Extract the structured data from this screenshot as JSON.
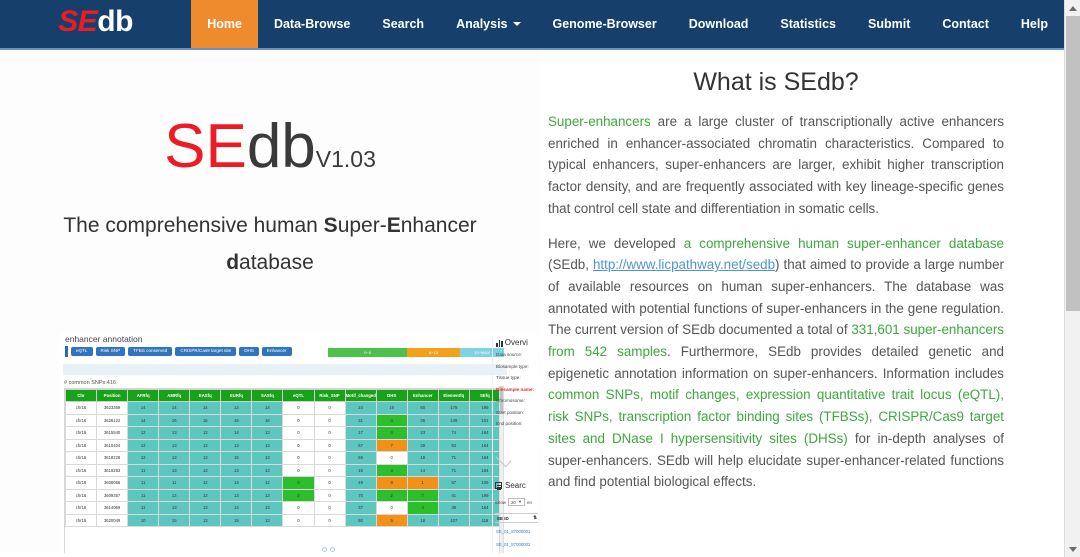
{
  "navbar": {
    "brand_se": "SE",
    "brand_db": "db",
    "items": [
      {
        "label": "Home",
        "active": true
      },
      {
        "label": "Data-Browse",
        "active": false
      },
      {
        "label": "Search",
        "active": false
      },
      {
        "label": "Analysis",
        "active": false,
        "dropdown": true
      },
      {
        "label": "Genome-Browser",
        "active": false
      },
      {
        "label": "Download",
        "active": false
      },
      {
        "label": "Statistics",
        "active": false
      },
      {
        "label": "Submit",
        "active": false
      },
      {
        "label": "Contact",
        "active": false
      },
      {
        "label": "Help",
        "active": false
      }
    ],
    "colors": {
      "bar": "#16406B",
      "active": "#EE8C2D",
      "accent_red": "#ED1C24"
    }
  },
  "hero": {
    "logo_se": "SE",
    "logo_db": "db",
    "logo_version": "V1.03",
    "tagline_pre": "The comprehensive human ",
    "tagline_s": "S",
    "tagline_uper": "uper-",
    "tagline_e": "E",
    "tagline_nhancer": "nhancer",
    "tagline_d": "d",
    "tagline_atabase": "atabase"
  },
  "screenshot": {
    "title": "enhancer annotation",
    "badges": [
      "eQTL",
      "Risk SNP",
      "TFBS conserved",
      "CRISPR/Cas9 target site",
      "DHS",
      "Enhancer"
    ],
    "legend": [
      {
        "label": "0~5",
        "color": "#4CC14C"
      },
      {
        "label": "6~10",
        "color": "#F5A117"
      },
      {
        "label": "10~MAX",
        "color": "#7FD4E3"
      }
    ],
    "snp_note": "# common SNPs:416",
    "table": {
      "headers": [
        "Chr",
        "Position",
        "AFRfq",
        "AMRfq",
        "EASfq",
        "EURfq",
        "SASfq",
        "eQTL",
        "Risk_SNP",
        "Motif_changed",
        "DHS",
        "Enhancer",
        "Elementfq",
        "SEfq"
      ],
      "rows": [
        {
          "cells": [
            "chr16",
            "3623359",
            "14",
            "14",
            "14",
            "12",
            "14",
            "0",
            "0",
            "24",
            "19",
            "60",
            "179",
            "199"
          ],
          "styles": [
            "cWhite",
            "cWhite",
            "cTeal",
            "cTeal",
            "cTeal",
            "cTeal",
            "cTeal",
            "cWhite",
            "cWhite",
            "cTeal",
            "cTeal",
            "cTeal",
            "cTeal",
            "cTeal"
          ]
        },
        {
          "cells": [
            "chr16",
            "3626122",
            "14",
            "16",
            "15",
            "16",
            "16",
            "0",
            "0",
            "31",
            "4",
            "36",
            "149",
            "101"
          ],
          "styles": [
            "cWhite",
            "cWhite",
            "cTeal",
            "cTeal",
            "cTeal",
            "cTeal",
            "cTeal",
            "cWhite",
            "cWhite",
            "cTeal",
            "cGreen",
            "cTeal",
            "cTeal",
            "cTeal"
          ]
        },
        {
          "cells": [
            "chr16",
            "3615940",
            "12",
            "13",
            "13",
            "14",
            "13",
            "0",
            "0",
            "17",
            "4",
            "23",
            "74",
            "164"
          ],
          "styles": [
            "cWhite",
            "cWhite",
            "cTeal",
            "cTeal",
            "cTeal",
            "cTeal",
            "cTeal",
            "cWhite",
            "cWhite",
            "cTeal",
            "cGreen",
            "cTeal",
            "cTeal",
            "cTeal"
          ]
        },
        {
          "cells": [
            "chr16",
            "3610404",
            "12",
            "13",
            "13",
            "13",
            "13",
            "0",
            "0",
            "67",
            "7",
            "39",
            "64",
            "164"
          ],
          "styles": [
            "cWhite",
            "cWhite",
            "cTeal",
            "cTeal",
            "cTeal",
            "cTeal",
            "cTeal",
            "cWhite",
            "cWhite",
            "cTeal",
            "cOrange",
            "cTeal",
            "cTeal",
            "cTeal"
          ]
        },
        {
          "cells": [
            "chr16",
            "3618228",
            "12",
            "13",
            "13",
            "15",
            "13",
            "0",
            "0",
            "55",
            "0",
            "18",
            "71",
            "164"
          ],
          "styles": [
            "cWhite",
            "cWhite",
            "cTeal",
            "cTeal",
            "cTeal",
            "cTeal",
            "cTeal",
            "cWhite",
            "cWhite",
            "cTeal",
            "cWhite",
            "cTeal",
            "cTeal",
            "cTeal"
          ]
        },
        {
          "cells": [
            "chr16",
            "3616283",
            "11",
            "13",
            "13",
            "13",
            "13",
            "0",
            "0",
            "19",
            "3",
            "14",
            "71",
            "164"
          ],
          "styles": [
            "cWhite",
            "cWhite",
            "cTeal",
            "cTeal",
            "cTeal",
            "cTeal",
            "cTeal",
            "cWhite",
            "cWhite",
            "cTeal",
            "cGreen",
            "cTeal",
            "cTeal",
            "cTeal"
          ]
        },
        {
          "cells": [
            "chr16",
            "3608066",
            "11",
            "11",
            "12",
            "14",
            "12",
            "3",
            "0",
            "49",
            "9",
            "1",
            "57",
            "109"
          ],
          "styles": [
            "cWhite",
            "cWhite",
            "cTeal",
            "cTeal",
            "cTeal",
            "cTeal",
            "cTeal",
            "cGreen",
            "cWhite",
            "cTeal",
            "cOrange",
            "cOrange",
            "cTeal",
            "cTeal"
          ]
        },
        {
          "cells": [
            "chr16",
            "3609357",
            "11",
            "12",
            "13",
            "13",
            "13",
            "2",
            "0",
            "70",
            "2",
            "7",
            "41",
            "199"
          ],
          "styles": [
            "cWhite",
            "cWhite",
            "cTeal",
            "cTeal",
            "cTeal",
            "cTeal",
            "cTeal",
            "cGreen",
            "cWhite",
            "cTeal",
            "cGreen",
            "cGreen",
            "cTeal",
            "cTeal"
          ]
        },
        {
          "cells": [
            "chr16",
            "3614069",
            "11",
            "13",
            "13",
            "14",
            "13",
            "0",
            "0",
            "37",
            "0",
            "4",
            "39",
            "164"
          ],
          "styles": [
            "cWhite",
            "cWhite",
            "cTeal",
            "cTeal",
            "cTeal",
            "cTeal",
            "cTeal",
            "cWhite",
            "cWhite",
            "cTeal",
            "cWhite",
            "cGreen",
            "cTeal",
            "cTeal"
          ]
        },
        {
          "cells": [
            "chr16",
            "3620049",
            "10",
            "15",
            "13",
            "15",
            "13",
            "0",
            "0",
            "80",
            "5",
            "16",
            "107",
            "116"
          ],
          "styles": [
            "cWhite",
            "cWhite",
            "cTeal",
            "cTeal",
            "cTeal",
            "cTeal",
            "cTeal",
            "cWhite",
            "cWhite",
            "cTeal",
            "cOrange",
            "cTeal",
            "cTeal",
            "cTeal"
          ]
        }
      ]
    },
    "sidebar": {
      "overview_title": "Overvi",
      "fields": [
        {
          "label": "Data source:",
          "highlight": false
        },
        {
          "label": "Biosample type:",
          "highlight": false
        },
        {
          "label": "Tissue type:",
          "highlight": false
        },
        {
          "label": "Biosample name:",
          "highlight": true
        },
        {
          "label": "Chromosome:",
          "highlight": false
        },
        {
          "label": "Start position:",
          "highlight": false
        },
        {
          "label": "End position:",
          "highlight": false
        }
      ],
      "search_title": "Searc",
      "show_label": "Show",
      "show_value": "20",
      "entries_label": "en",
      "seid_header": "SE ID",
      "seid_sort": "⇅",
      "rows": [
        "SE_01_87000001",
        "SE_01_87000002"
      ]
    }
  },
  "article": {
    "title": "What is SEdb?",
    "p1": {
      "lead": "Super-enhancers",
      "rest": " are a large cluster of transcriptionally active enhancers enriched in enhancer-associated chromatin characteristics. Compared to typical enhancers, super-enhancers are larger, exhibit higher transcription factor density, and are frequently associated with key lineage-specific genes that control cell state and differentiation in somatic cells."
    },
    "p2": {
      "t1": "Here, we developed ",
      "g1": "a comprehensive human super-enhancer database",
      "t2": " (SEdb, ",
      "link": "http://www.licpathway.net/sedb",
      "t3": ") that aimed to provide a large number of available resources on human super-enhancers. The database was annotated with potential functions of super-enhancers in the gene regulation. The current version of SEdb documented a total of ",
      "g2": "331,601 super-enhancers from 542 samples",
      "t4": ". Furthermore, SEdb provides detailed genetic and epigenetic annotation information on super-enhancers. Information includes ",
      "g3": "common SNPs, motif changes, expression quantitative trait locus (eQTL), risk SNPs, transcription factor binding sites (TFBSs), CRISPR/Cas9 target sites and DNase I hypersensitivity sites (DHSs)",
      "t5": " for in-depth analyses of super-enhancers. SEdb will help elucidate super-enhancer-related functions and find potential biological effects."
    }
  }
}
